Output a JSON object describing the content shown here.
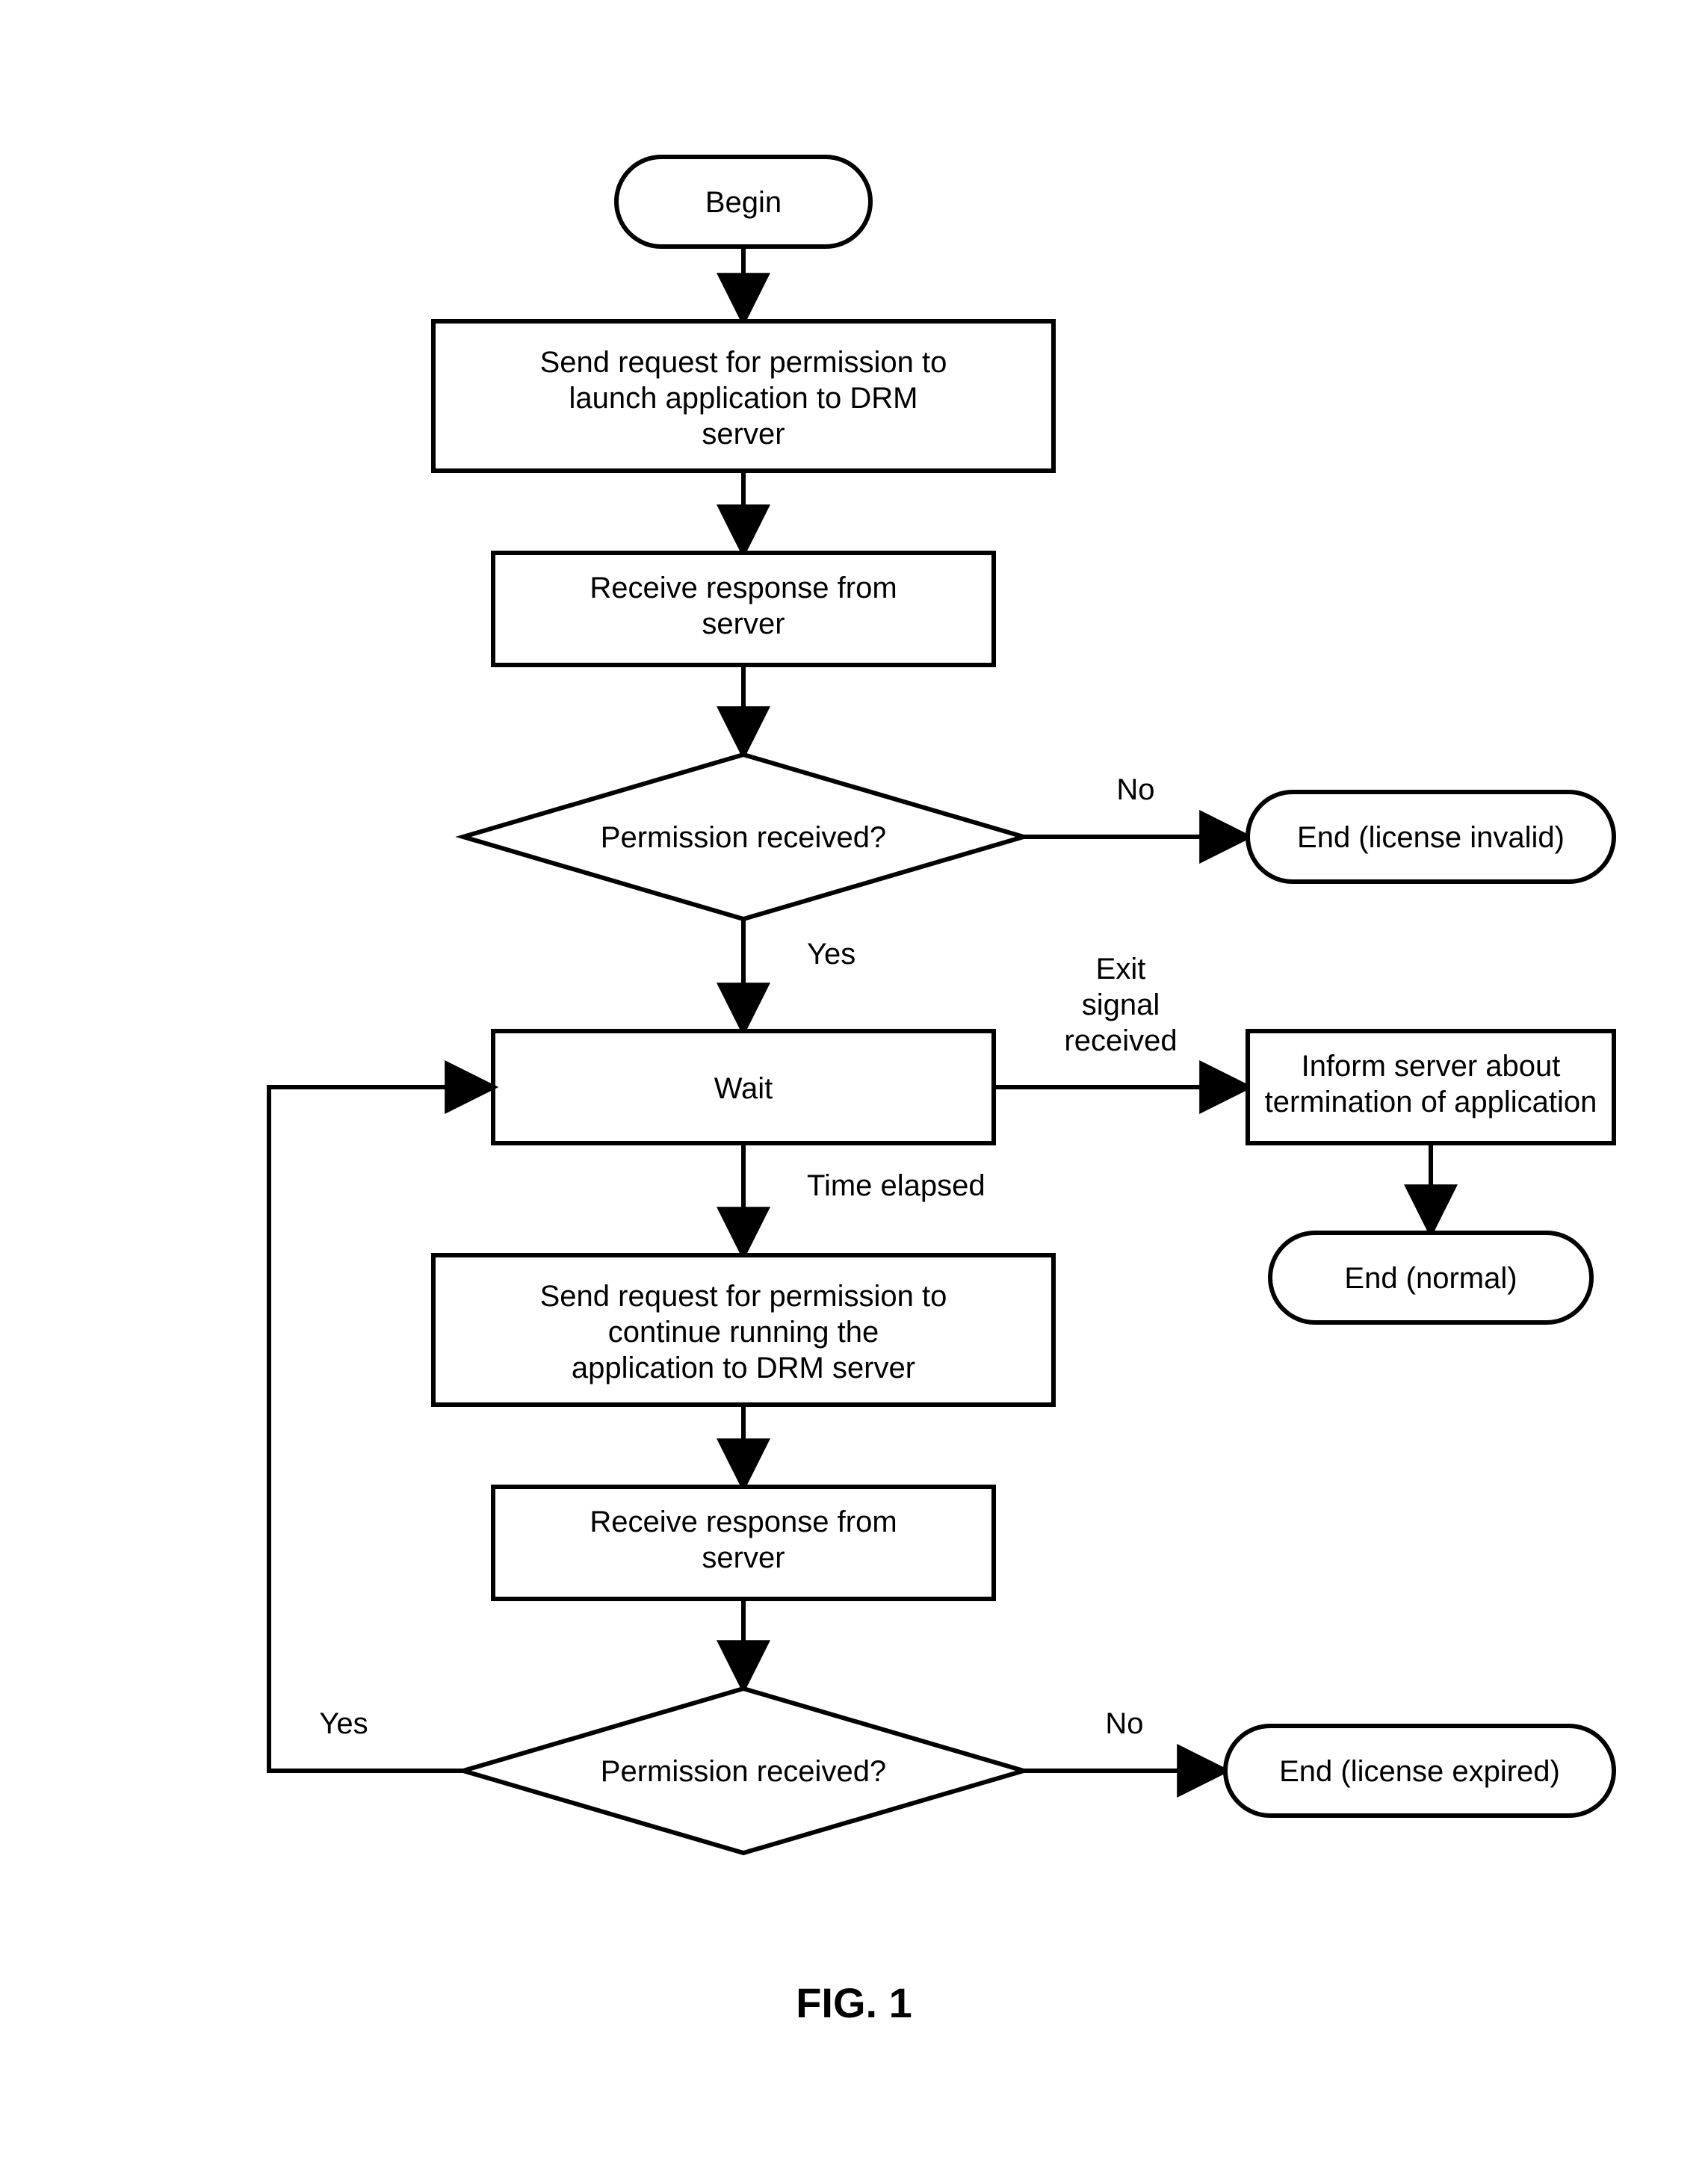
{
  "caption": "FIG. 1",
  "nodes": {
    "begin": {
      "label": "Begin"
    },
    "send_launch": {
      "label": "Send request for permission to\nlaunch application to DRM\nserver"
    },
    "recv1": {
      "label": "Receive response from\nserver"
    },
    "perm1": {
      "label": "Permission received?"
    },
    "end_invalid": {
      "label": "End (license invalid)"
    },
    "wait": {
      "label": "Wait"
    },
    "inform": {
      "label": "Inform server about\ntermination of application"
    },
    "end_normal": {
      "label": "End (normal)"
    },
    "send_continue": {
      "label": "Send request for permission to\ncontinue running the\napplication to DRM server"
    },
    "recv2": {
      "label": "Receive response from\nserver"
    },
    "perm2": {
      "label": "Permission received?"
    },
    "end_expired": {
      "label": "End (license expired)"
    }
  },
  "edges": {
    "perm1_no": {
      "label": "No"
    },
    "perm1_yes": {
      "label": "Yes"
    },
    "wait_exit": {
      "label": "Exit\nsignal\nreceived"
    },
    "wait_time": {
      "label": "Time elapsed"
    },
    "perm2_no": {
      "label": "No"
    },
    "perm2_yes": {
      "label": "Yes"
    }
  }
}
